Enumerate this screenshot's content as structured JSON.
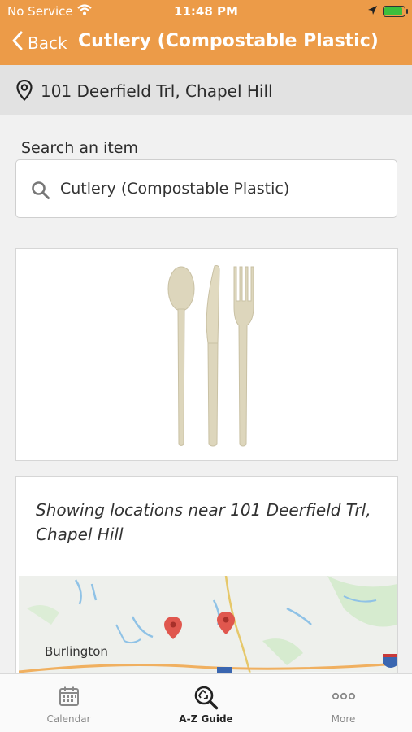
{
  "status_bar": {
    "carrier": "No Service",
    "time": "11:48 PM"
  },
  "header": {
    "back_label": "Back",
    "title": "Cutlery (Compostable Plastic)",
    "color": "#ec9b48"
  },
  "address_bar": {
    "address": "101 Deerfield Trl, Chapel Hill"
  },
  "search": {
    "label": "Search an item",
    "value": "Cutlery (Compostable Plastic)"
  },
  "item_image": {
    "description_icon": "cutlery-image"
  },
  "locations": {
    "text": "Showing locations near 101 Deerfield Trl, Chapel Hill",
    "map": {
      "town": "Burlington"
    }
  },
  "tabs": [
    {
      "label": "Calendar",
      "icon": "calendar-icon",
      "active": false
    },
    {
      "label": "A-Z Guide",
      "icon": "recycle-search-icon",
      "active": true
    },
    {
      "label": "More",
      "icon": "more-icon",
      "active": false
    }
  ]
}
